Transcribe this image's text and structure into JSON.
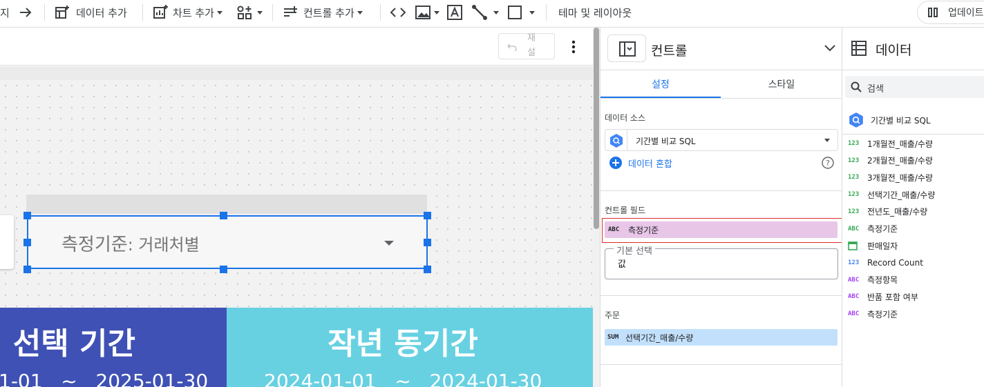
{
  "toolbar": {
    "page_fragment": "지",
    "add_data": "데이터 추가",
    "add_chart": "차트 추가",
    "add_control": "컨트롤 추가",
    "theme_layout": "테마 및 레이아웃",
    "update": "업데이트"
  },
  "canvas": {
    "reset_label": "재설정",
    "control_title": "측정기준",
    "control_value": ": 거래처별",
    "scorecards": [
      {
        "title": "선택 기간",
        "range": "1-01   ~   2025-01-30",
        "color": "#3f51b5"
      },
      {
        "title": "작년 동기간",
        "range": "2024-01-01   ~   2024-01-30",
        "color": "#67d1e2"
      }
    ]
  },
  "control_panel": {
    "title": "컨트롤",
    "tabs": [
      "설정",
      "스타일"
    ],
    "active_tab": 0,
    "data_source_label": "데이터 소스",
    "data_source_value": "기간별 비교 SQL",
    "blend_data": "데이터 혼합",
    "control_field_label": "컨트롤 필드",
    "control_field_type": "ABC",
    "control_field_value": "측정기준",
    "default_selection_label": "기본 선택",
    "default_selection_value": "값",
    "order_label": "주문",
    "order_type": "SUM",
    "order_value": "선택기간_매출/수량"
  },
  "data_panel": {
    "title": "데이터",
    "search_placeholder": "검색",
    "source_name": "기간별 비교 SQL",
    "fields": [
      {
        "type": "123",
        "name": "1개월전_매출/수량",
        "color": "#34a853"
      },
      {
        "type": "123",
        "name": "2개월전_매출/수량",
        "color": "#34a853"
      },
      {
        "type": "123",
        "name": "3개월전_매출/수량",
        "color": "#34a853"
      },
      {
        "type": "123",
        "name": "선택기간_매출/수량",
        "color": "#34a853"
      },
      {
        "type": "123",
        "name": "전년도_매출/수량",
        "color": "#34a853"
      },
      {
        "type": "ABC",
        "name": "측정기준",
        "color": "#34a853"
      },
      {
        "type": "date",
        "name": "판매일자",
        "color": "#34a853"
      },
      {
        "type": "123",
        "name": "Record Count",
        "color": "#4285f4"
      },
      {
        "type": "ABC",
        "name": "측정항목",
        "color": "#a142f4"
      },
      {
        "type": "ABC",
        "name": "반품 포함 여부",
        "color": "#a142f4"
      },
      {
        "type": "ABC",
        "name": "측정기준",
        "color": "#a142f4"
      }
    ]
  },
  "colors": {
    "accent": "#1a73e8",
    "selection": "#1a73e8",
    "control_field_bg": "#e8c6e8",
    "order_bg": "#c2e0fb",
    "highlight_border": "#d93025"
  }
}
